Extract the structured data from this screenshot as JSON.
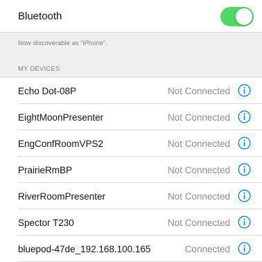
{
  "bluetooth": {
    "label": "Bluetooth",
    "enabled": true,
    "toggle_color": "#4cd964"
  },
  "discoverable_text": "Now discoverable as “iPhone”.",
  "my_devices_header": "MY DEVICES",
  "accent_color": "#007aff",
  "devices": [
    {
      "name": "Echo Dot-08P",
      "status": "Not Connected",
      "icon": "info-icon"
    },
    {
      "name": "EightMoonPresenter",
      "status": "Not Connected",
      "icon": "info-icon"
    },
    {
      "name": "EngConfRoomVPS2",
      "status": "Not Connected",
      "icon": "info-icon"
    },
    {
      "name": "PrairieRmBP",
      "status": "Not Connected",
      "icon": "info-icon"
    },
    {
      "name": "RiverRoomPresenter",
      "status": "Not Connected",
      "icon": "info-icon"
    },
    {
      "name": "Spector T230",
      "status": "Not Connected",
      "icon": "info-icon"
    },
    {
      "name": "bluepod-47de_192.168.100.165",
      "status": "Connected",
      "icon": "info-icon"
    }
  ]
}
